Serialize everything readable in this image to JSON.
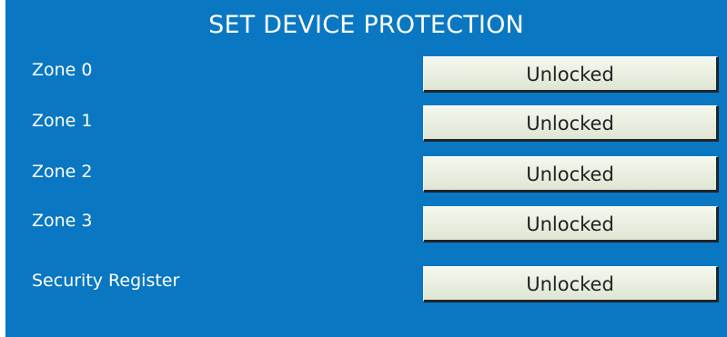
{
  "title": "SET DEVICE PROTECTION",
  "rows": [
    {
      "label": "Zone 0",
      "status": "Unlocked"
    },
    {
      "label": "Zone 1",
      "status": "Unlocked"
    },
    {
      "label": "Zone 2",
      "status": "Unlocked"
    },
    {
      "label": "Zone 3",
      "status": "Unlocked"
    },
    {
      "label": "Security Register",
      "status": "Unlocked"
    }
  ],
  "colors": {
    "panel_background": "#0a77c2",
    "button_face": "#e9efe1",
    "button_text": "#222222"
  }
}
